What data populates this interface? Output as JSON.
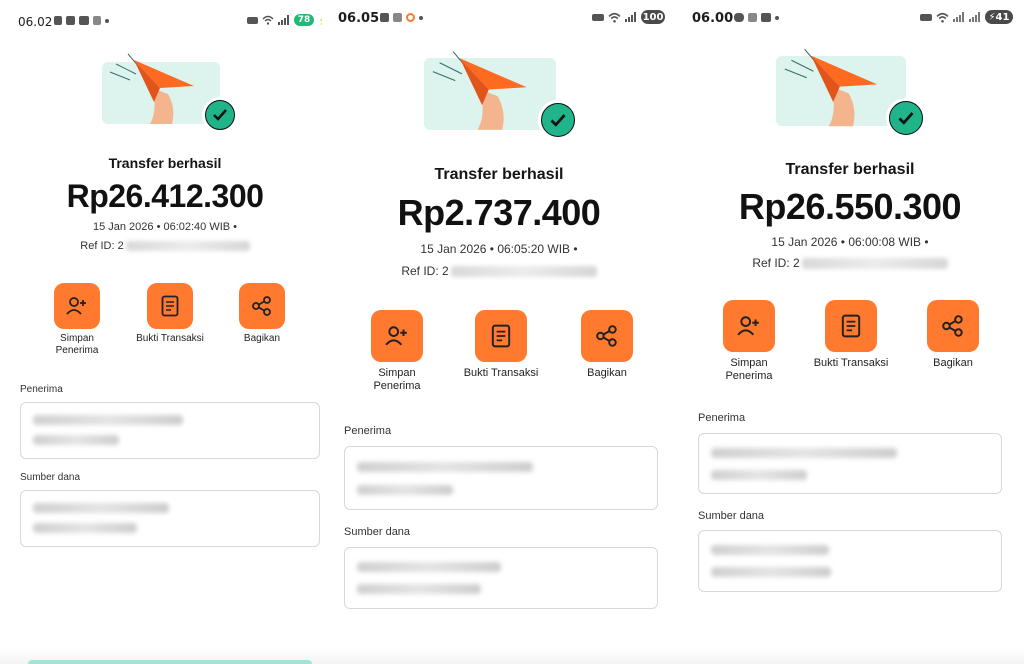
{
  "panels": [
    {
      "status": {
        "time": "06.02",
        "battery": "78"
      },
      "title": "Transfer berhasil",
      "amount": "Rp26.412.300",
      "datetime": "15 Jan 2026 • 06:02:40 WIB •",
      "ref_prefix": "Ref ID: 2",
      "actions": {
        "save": "Simpan Penerima",
        "receipt": "Bukti Transaksi",
        "share": "Bagikan"
      },
      "recipient_label": "Penerima",
      "source_label": "Sumber dana"
    },
    {
      "status": {
        "time": "06.05",
        "battery": "100"
      },
      "title": "Transfer berhasil",
      "amount": "Rp2.737.400",
      "datetime": "15 Jan 2026 • 06:05:20 WIB •",
      "ref_prefix": "Ref ID: 2",
      "actions": {
        "save": "Simpan Penerima",
        "receipt": "Bukti Transaksi",
        "share": "Bagikan"
      },
      "recipient_label": "Penerima",
      "source_label": "Sumber dana"
    },
    {
      "status": {
        "time": "06.00",
        "battery": "41"
      },
      "title": "Transfer berhasil",
      "amount": "Rp26.550.300",
      "datetime": "15 Jan 2026 • 06:00:08 WIB •",
      "ref_prefix": "Ref ID: 2",
      "actions": {
        "save": "Simpan Penerima",
        "receipt": "Bukti Transaksi",
        "share": "Bagikan"
      },
      "recipient_label": "Penerima",
      "source_label": "Sumber dana"
    }
  ],
  "colors": {
    "accent": "#ff7a2f",
    "success": "#1fb48a",
    "illustration_bg": "#dcf3ee",
    "battery_green": "#1fb97a",
    "battery_dark": "#4a4a4a"
  },
  "icons": [
    "add-user-icon",
    "document-icon",
    "share-icon",
    "paper-plane-icon",
    "check-icon"
  ]
}
